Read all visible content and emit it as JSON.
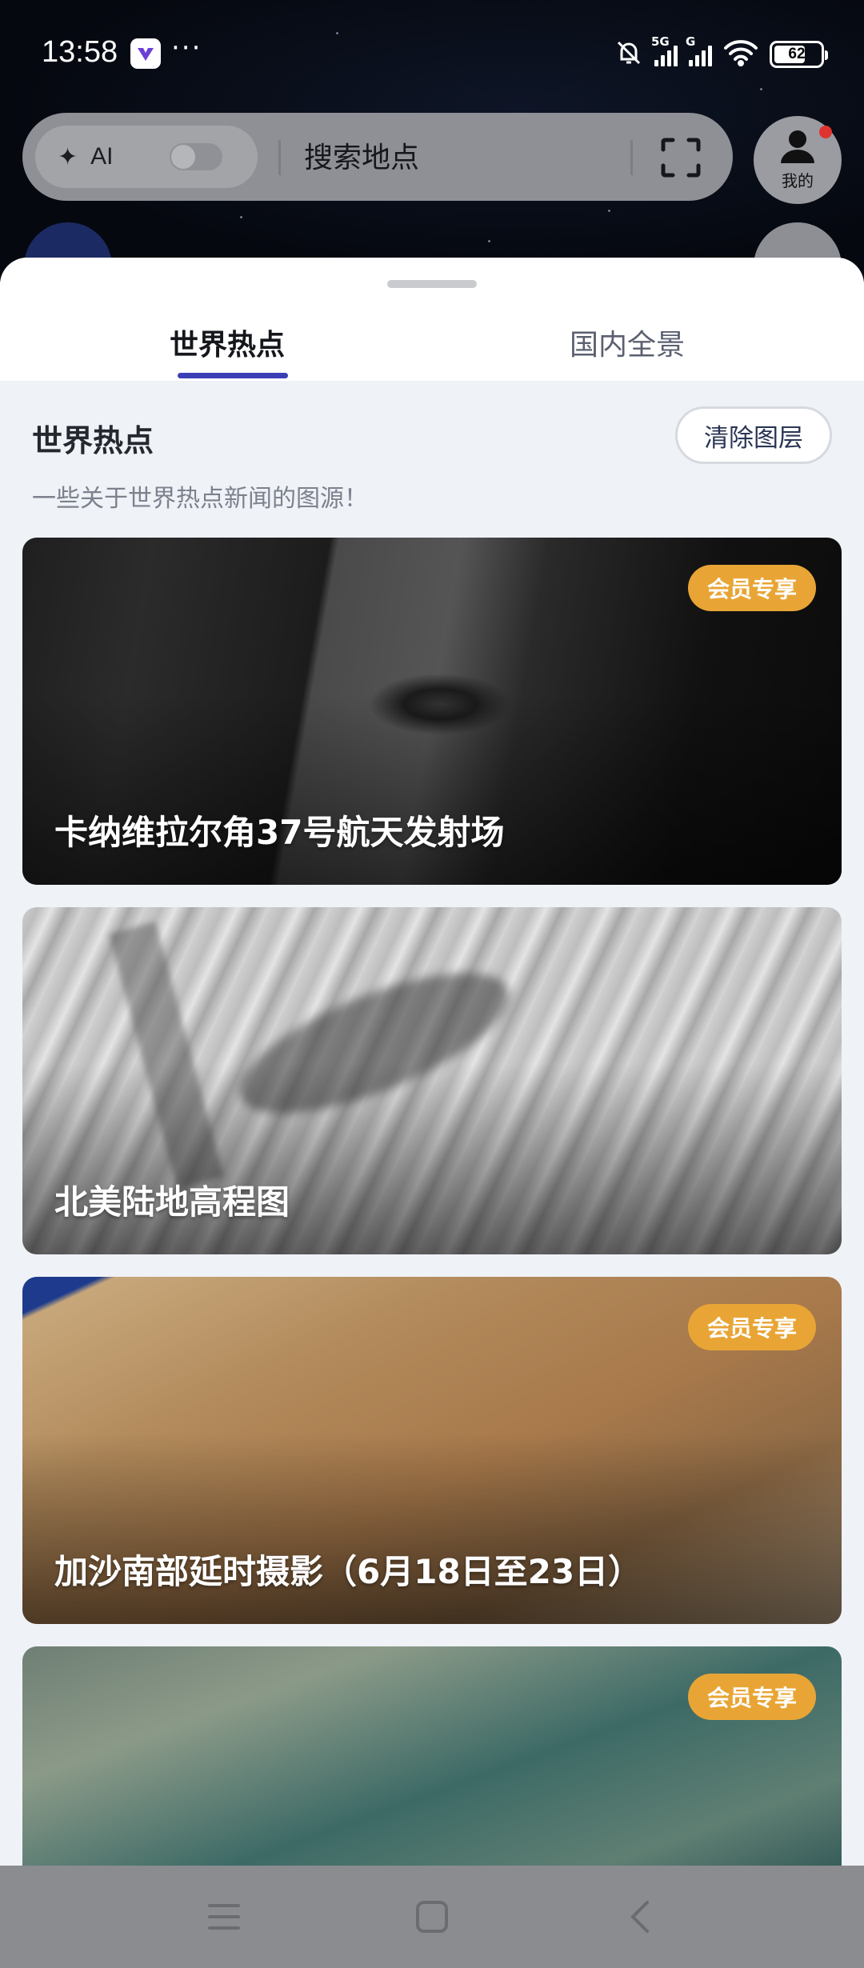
{
  "status_bar": {
    "time": "13:58",
    "more": "···",
    "network_5g": "5G",
    "network_g": "G",
    "battery": "62"
  },
  "search": {
    "ai_label": "AI",
    "placeholder": "搜索地点"
  },
  "profile": {
    "label": "我的"
  },
  "tabs": [
    {
      "label": "世界热点",
      "active": true
    },
    {
      "label": "国内全景",
      "active": false
    }
  ],
  "section": {
    "title": "世界热点",
    "clear_label": "清除图层",
    "subtitle": "一些关于世界热点新闻的图源！"
  },
  "cards": [
    {
      "title": "卡纳维拉尔角37号航天发射场",
      "badge": "会员专享"
    },
    {
      "title": "北美陆地高程图",
      "badge": ""
    },
    {
      "title": "加沙南部延时摄影（6月18日至23日）",
      "badge": "会员专享"
    },
    {
      "title": "",
      "badge": "会员专享"
    }
  ],
  "colors": {
    "accent": "#3b3fb6",
    "vip": "#e8a535",
    "notification_dot": "#e0322f"
  }
}
